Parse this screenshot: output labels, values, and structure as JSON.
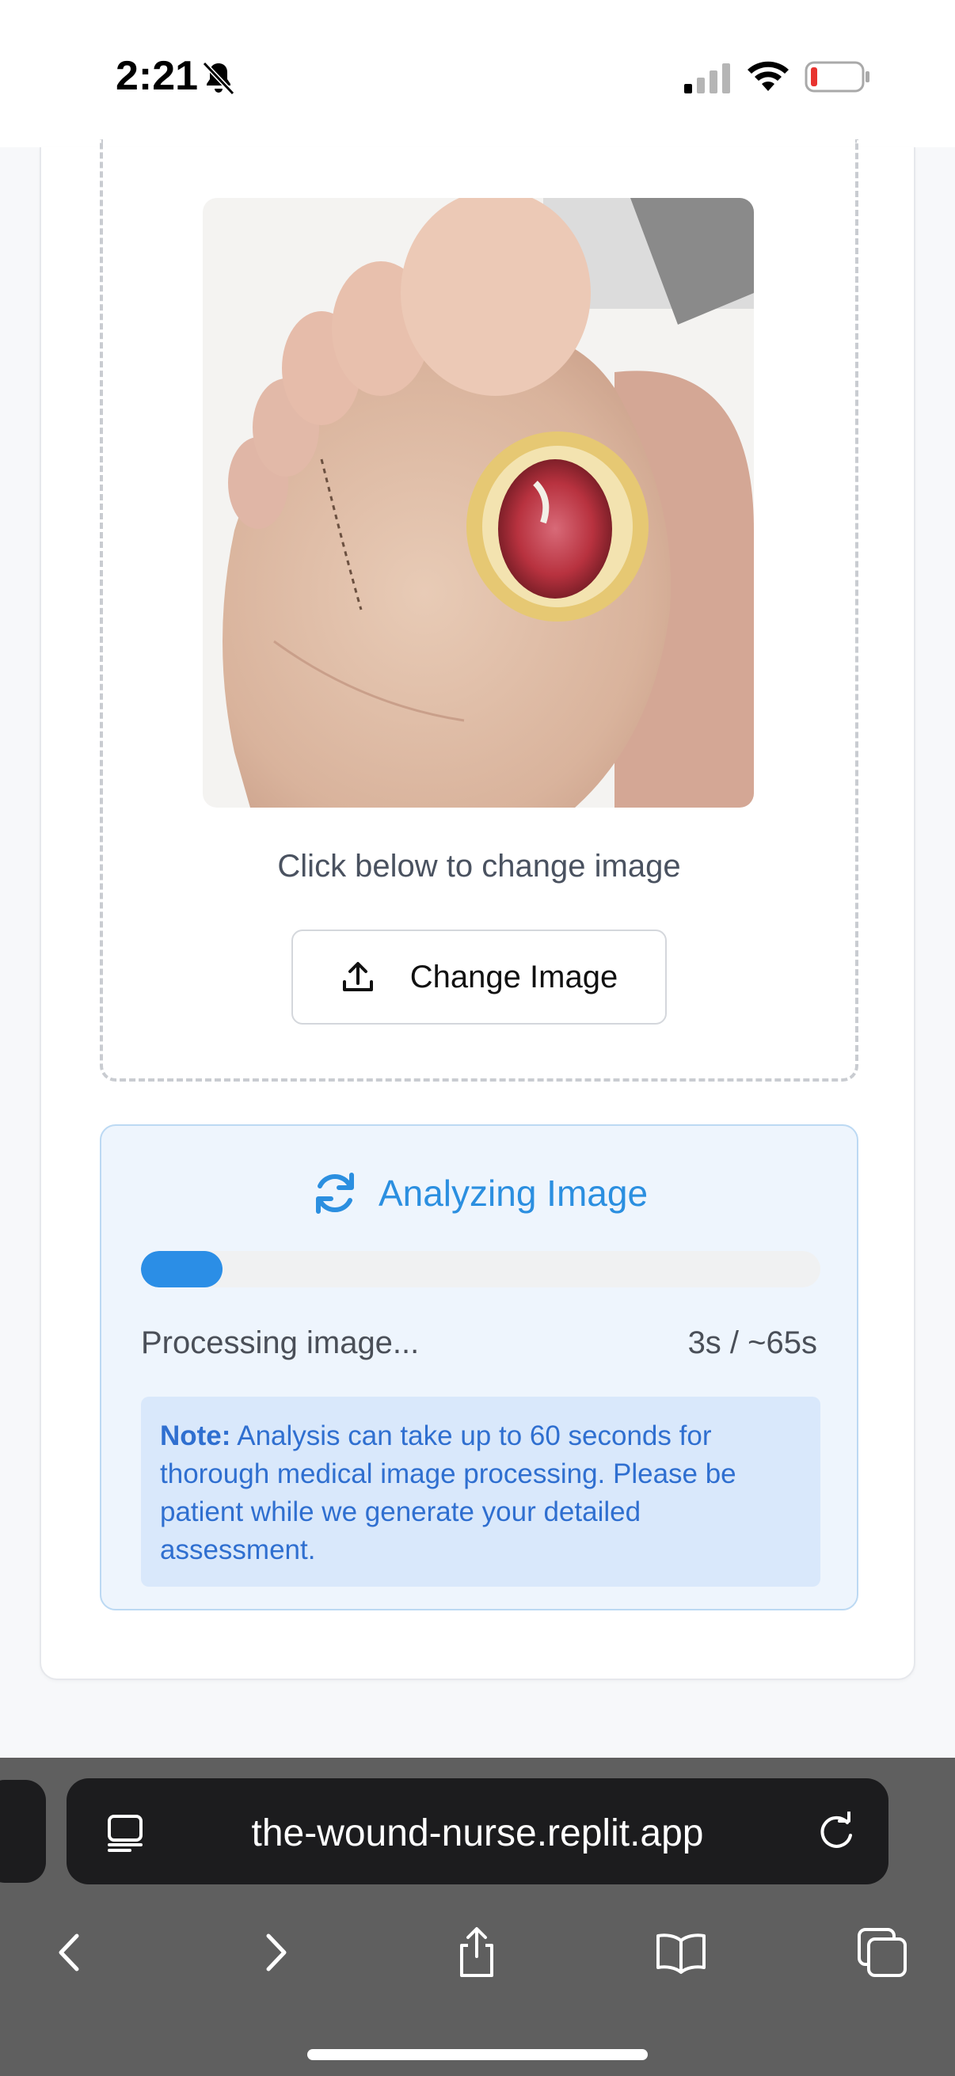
{
  "status_bar": {
    "time": "2:21"
  },
  "upload": {
    "change_hint": "Click below to change image",
    "change_button_label": "Change Image"
  },
  "analysis": {
    "title": "Analyzing Image",
    "progress_fraction": 0.12,
    "status_text": "Processing image...",
    "elapsed_text": "3s / ~65s",
    "note_label": "Note:",
    "note_text": " Analysis can take up to 60 seconds for thorough medical image processing. Please be patient while we generate your detailed assessment."
  },
  "browser": {
    "url": "the-wound-nurse.replit.app",
    "toolbar_icons": [
      "back-icon",
      "forward-icon",
      "share-icon",
      "bookmarks-icon",
      "tabs-icon"
    ]
  },
  "colors": {
    "accent": "#2b8ee6",
    "panel_bg": "#eef5fd",
    "note_bg": "#d9e8fb"
  }
}
